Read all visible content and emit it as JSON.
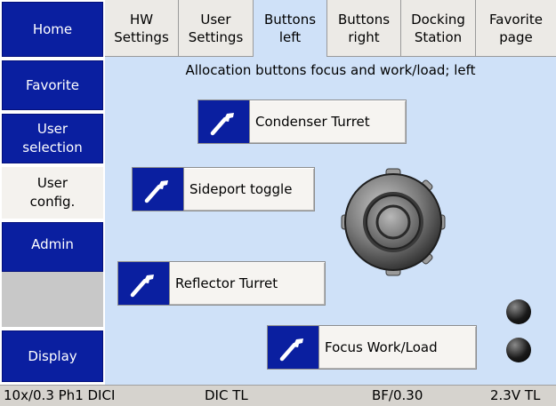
{
  "sidebar": {
    "items": [
      {
        "label": "Home"
      },
      {
        "label": "Favorite"
      },
      {
        "label": "User selection"
      },
      {
        "label": "User config."
      },
      {
        "label": "Admin"
      },
      {
        "label": ""
      },
      {
        "label": "Display"
      }
    ]
  },
  "tabs": [
    {
      "label": "HW Settings"
    },
    {
      "label": "User Settings"
    },
    {
      "label": "Buttons left"
    },
    {
      "label": "Buttons right"
    },
    {
      "label": "Docking Station"
    },
    {
      "label": "Favorite page"
    }
  ],
  "main": {
    "title": "Allocation buttons focus and work/load; left",
    "buttons": [
      {
        "label": "Condenser Turret",
        "icon": "wrench-icon"
      },
      {
        "label": "Sideport toggle",
        "icon": "wrench-icon"
      },
      {
        "label": "Reflector Turret",
        "icon": "wrench-icon"
      },
      {
        "label": "Focus Work/Load",
        "icon": "wrench-icon"
      }
    ]
  },
  "status": {
    "objective": "10x/0.3 Ph1 DICI",
    "contrast": "DIC TL",
    "field": "BF/0.30",
    "voltage": "2.3V TL"
  },
  "colors": {
    "accent_blue": "#0a1fa0",
    "panel_blue": "#cfe1f8",
    "status_bar": "#d6d3ce"
  }
}
